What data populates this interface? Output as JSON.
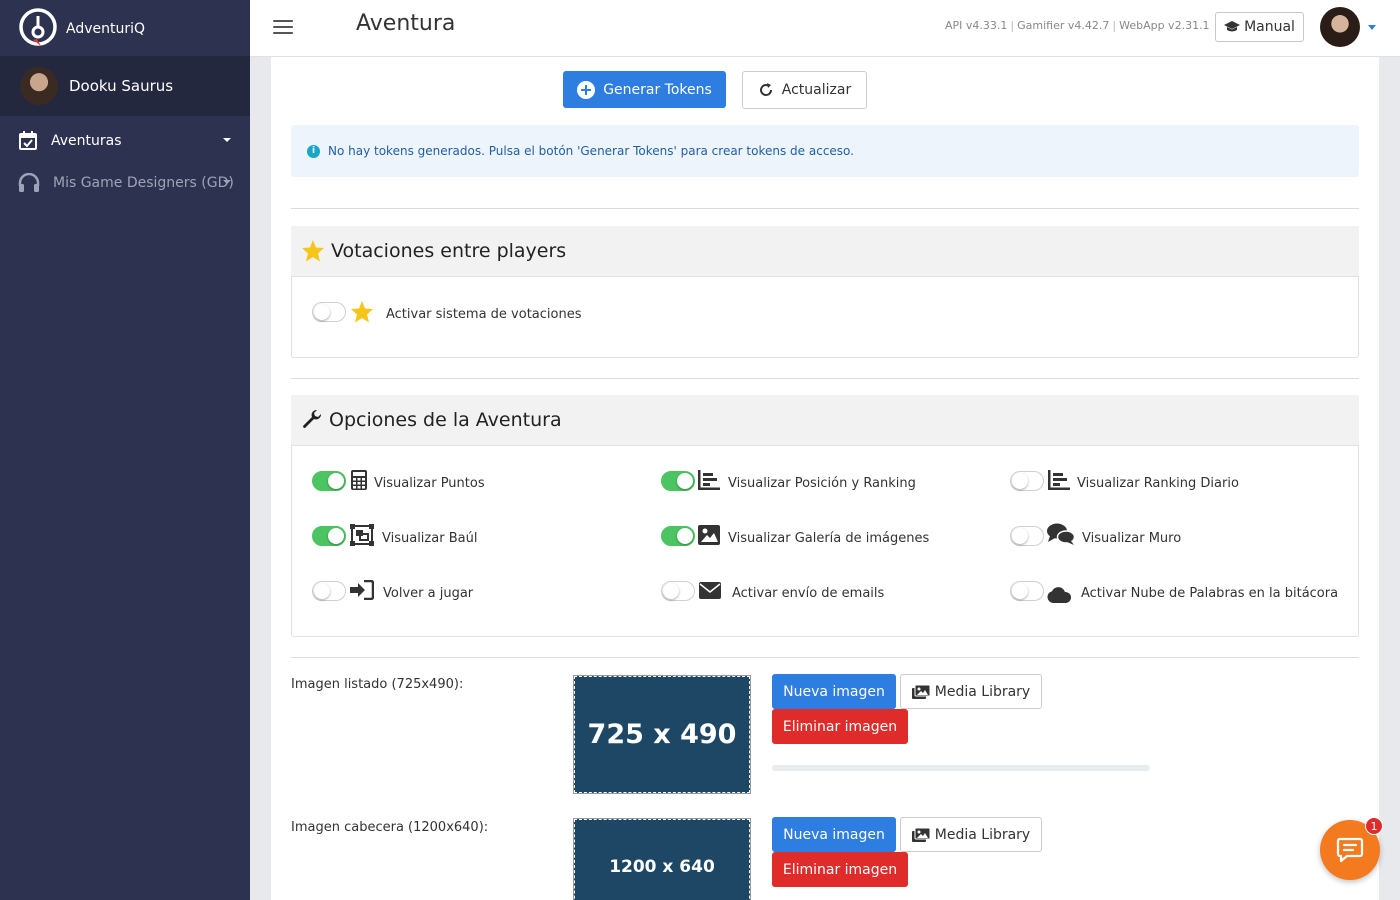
{
  "app": {
    "brand": "AdventuriQ",
    "user_name": "Dooku Saurus"
  },
  "sidebar": {
    "items": [
      {
        "label": "Aventuras",
        "icon": "calendar-check-icon"
      },
      {
        "label": "Mis Game Designers (GD)",
        "icon": "headphones-icon"
      }
    ]
  },
  "header": {
    "title": "Aventura",
    "versions": [
      "API v4.33.1",
      "Gamifier v4.42.7",
      "WebApp v2.31.1"
    ],
    "separator": "|",
    "manual_label": "Manual"
  },
  "tokens": {
    "generate_label": "Generar Tokens",
    "refresh_label": "Actualizar",
    "info": "No hay tokens generados. Pulsa el botón 'Generar Tokens' para crear tokens de acceso."
  },
  "voting": {
    "title": "Votaciones entre players",
    "toggle_label": "Activar sistema de votaciones",
    "enabled": false
  },
  "options": {
    "title": "Opciones de la Aventura",
    "items": [
      {
        "label": "Visualizar Puntos",
        "enabled": true,
        "icon": "calculator-icon"
      },
      {
        "label": "Visualizar Posición y Ranking",
        "enabled": true,
        "icon": "bar-chart-icon"
      },
      {
        "label": "Visualizar Ranking Diario",
        "enabled": false,
        "icon": "bar-chart-icon"
      },
      {
        "label": "Visualizar Baúl",
        "enabled": true,
        "icon": "object-group-icon"
      },
      {
        "label": "Visualizar Galería de imágenes",
        "enabled": true,
        "icon": "image-icon"
      },
      {
        "label": "Visualizar Muro",
        "enabled": false,
        "icon": "comments-icon"
      },
      {
        "label": "Volver a jugar",
        "enabled": false,
        "icon": "sign-in-icon"
      },
      {
        "label": "Activar envío de emails",
        "enabled": false,
        "icon": "envelope-icon"
      },
      {
        "label": "Activar Nube de Palabras en la bitácora",
        "enabled": false,
        "icon": "cloud-icon"
      }
    ]
  },
  "images": [
    {
      "label": "Imagen listado (725x490):",
      "preview_text": "725 x 490",
      "new_label": "Nueva imagen",
      "media_label": "Media Library",
      "delete_label": "Eliminar imagen",
      "progress": 0
    },
    {
      "label": "Imagen cabecera (1200x640):",
      "preview_text": "1200 x 640",
      "new_label": "Nueva imagen",
      "media_label": "Media Library",
      "delete_label": "Eliminar imagen"
    }
  ],
  "chat": {
    "badge": "1"
  },
  "colors": {
    "sidebar": "#2d3250",
    "primary": "#2e7de1",
    "danger": "#e02b2b",
    "toggle_on": "#4cc461",
    "chat": "#f47a20"
  }
}
